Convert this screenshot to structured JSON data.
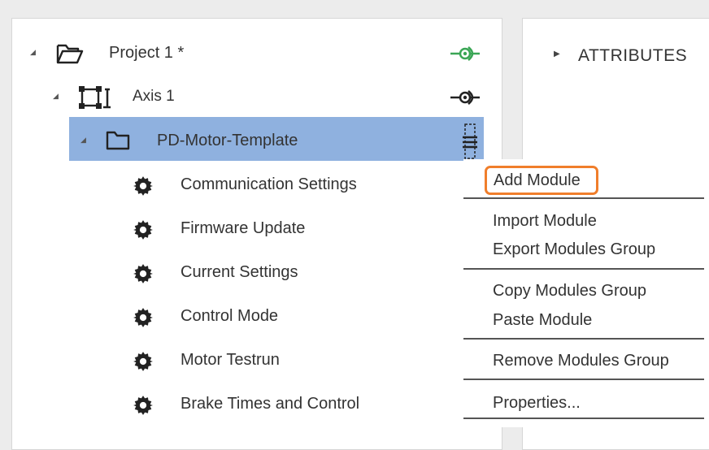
{
  "tree": {
    "project": {
      "label": "Project 1 *"
    },
    "axis": {
      "label": "Axis 1"
    },
    "template": {
      "label": "PD-Motor-Template"
    },
    "modules": [
      {
        "label": "Communication Settings"
      },
      {
        "label": "Firmware Update"
      },
      {
        "label": "Current Settings"
      },
      {
        "label": "Control Mode"
      },
      {
        "label": "Motor Testrun"
      },
      {
        "label": "Brake Times and Control"
      }
    ]
  },
  "context_menu": {
    "add_module": "Add Module",
    "import_module": "Import Module",
    "export_modules_group": "Export Modules Group",
    "copy_modules_group": "Copy Modules Group",
    "paste_module": "Paste Module",
    "remove_modules_group": "Remove Modules Group",
    "properties": "Properties..."
  },
  "attributes": {
    "title": "ATTRIBUTES"
  },
  "colors": {
    "selection": "#8fb1df",
    "highlight_border": "#f07e2b",
    "connect_active": "#3aa655"
  }
}
